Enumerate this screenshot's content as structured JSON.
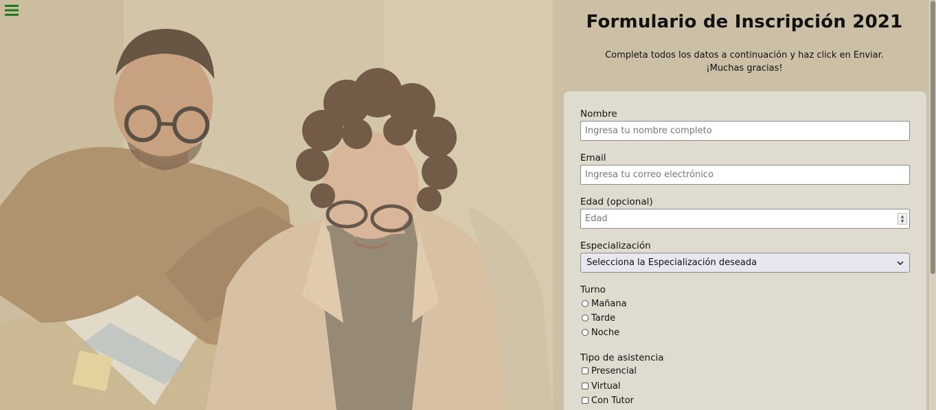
{
  "menu": {
    "icon": "hamburger-icon",
    "color": "#1a7a1a"
  },
  "header": {
    "title": "Formulario de Inscripción 2021",
    "subtitle_line1": "Completa todos los datos a continuación y haz click en Enviar.",
    "subtitle_line2": "¡Muchas gracias!"
  },
  "form": {
    "nombre": {
      "label": "Nombre",
      "placeholder": "Ingresa tu nombre completo"
    },
    "email": {
      "label": "Email",
      "placeholder": "Ingresa tu correo electrónico"
    },
    "edad": {
      "label": "Edad (opcional)",
      "placeholder": "Edad"
    },
    "especializacion": {
      "label": "Especialización",
      "selected": "Selecciona la Especialización deseada"
    },
    "turno": {
      "label": "Turno",
      "options": [
        "Mañana",
        "Tarde",
        "Noche"
      ]
    },
    "asistencia": {
      "label": "Tipo de asistencia",
      "options": [
        "Presencial",
        "Virtual",
        "Con Tutor"
      ]
    }
  },
  "colors": {
    "page_bg": "#cbbfa6",
    "card_bg": "#e0dbcf",
    "accent": "#1a7a1a"
  }
}
